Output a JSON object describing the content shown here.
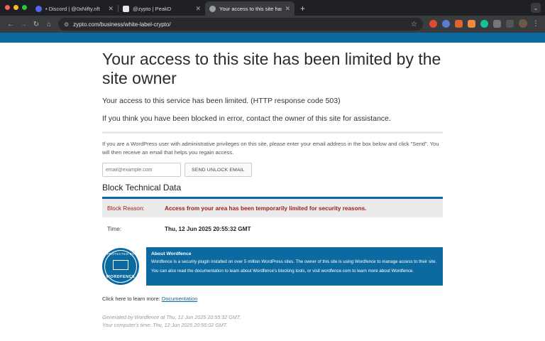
{
  "browser": {
    "tabs": [
      {
        "title": "• Discord | @0xNifty.nft",
        "color": "#5865f2"
      },
      {
        "title": "@zypto | PeakD",
        "color": "#e8e8e8"
      },
      {
        "title": "Your access to this site has b",
        "color": "#9aa0a6"
      }
    ],
    "url": "zypto.com/business/white-label-crypto/"
  },
  "page": {
    "heading": "Your access to this site has been limited by the site owner",
    "limited_text": "Your access to this service has been limited. (HTTP response code 503)",
    "contact_text": "If you think you have been blocked in error, contact the owner of this site for assistance.",
    "wp_text": "If you are a WordPress user with administrative privileges on this site, please enter your email address in the box below and click \"Send\". You will then receive an email that helps you regain access.",
    "email_placeholder": "email@example.com",
    "unlock_button": "SEND UNLOCK EMAIL",
    "tech_heading": "Block Technical Data",
    "block_reason_label": "Block Reason:",
    "block_reason_value": "Access from your area has been temporarily limited for security reasons.",
    "time_label": "Time:",
    "time_value": "Thu, 12 Jun 2025 20:55:32 GMT",
    "seal_top": "PROTECTED BY",
    "seal_bottom": "WORDFENCE",
    "about_title": "About Wordfence",
    "about_line1": "Wordfence is a security plugin installed on over 5 million WordPress sites. The owner of this site is using Wordfence to manage access to their site.",
    "about_line2": "You can also read the documentation to learn about Wordfence's blocking tools, or visit wordfence.com to learn more about Wordfence.",
    "learn_prefix": "Click here to learn more: ",
    "learn_link": "Documentation",
    "generated": "Generated by Wordfence at Thu, 12 Jun 2025 20:55:32 GMT.",
    "computer_time": "Your computer's time: Thu, 12 Jun 2025 20:56:02 GMT."
  }
}
